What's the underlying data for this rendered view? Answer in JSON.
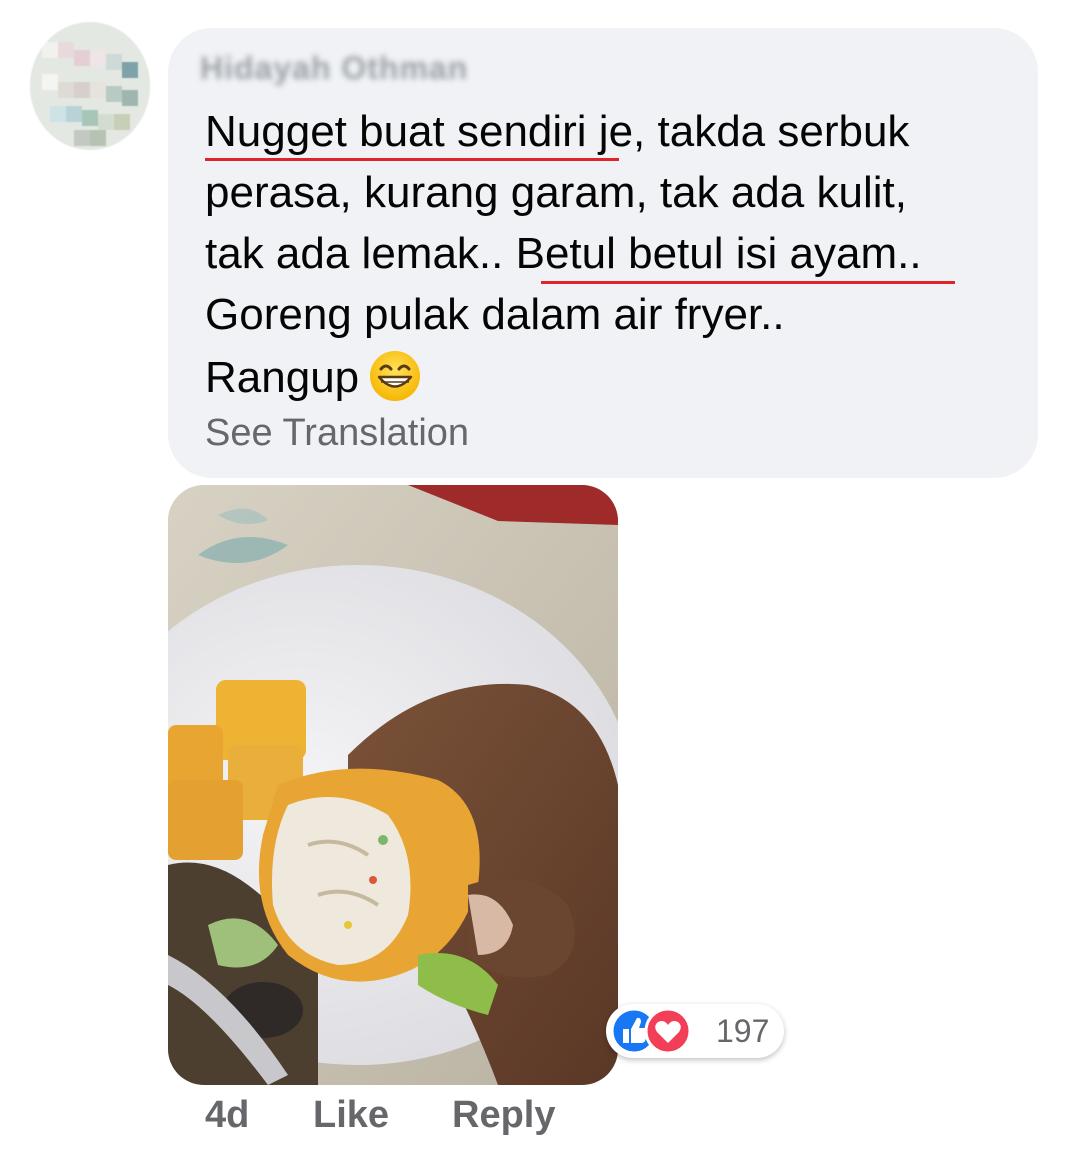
{
  "comment": {
    "author_name": "Hidayah Othman",
    "lines": [
      "Nugget buat sendiri je, takda serbuk",
      "perasa, kurang garam, tak ada kulit,",
      "tak ada lemak.. Betul betul isi ayam..",
      "Goreng pulak dalam air fryer..",
      "Rangup"
    ],
    "emoji": "grinning-face-with-smiling-eyes",
    "see_translation": "See Translation",
    "highlight_color": "#e0242b",
    "bubble_color": "#f0f2f5"
  },
  "photo": {
    "icon": "food-photo"
  },
  "reactions": {
    "icons": [
      "like-reaction-icon",
      "love-reaction-icon"
    ],
    "count": "197",
    "like_color": "#1877f2",
    "love_color": "#f33e58"
  },
  "actions": {
    "time": "4d",
    "like": "Like",
    "reply": "Reply"
  }
}
